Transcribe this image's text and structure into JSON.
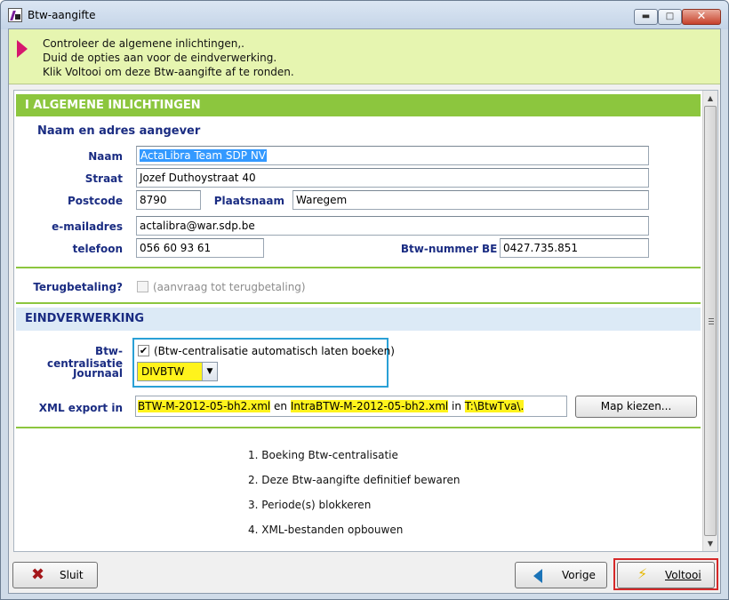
{
  "window": {
    "title": "Btw-aangifte"
  },
  "info": {
    "lines": [
      "Controleer de algemene inlichtingen,.",
      "Duid de opties aan voor de eindverwerking.",
      "Klik Voltooi om deze Btw-aangifte af te ronden."
    ]
  },
  "general": {
    "header": "I  ALGEMENE INLICHTINGEN",
    "subheader": "Naam en adres aangever",
    "name_label": "Naam",
    "name_value": "ActaLibra Team SDP NV",
    "street_label": "Straat",
    "street_value": "Jozef Duthoystraat 40",
    "postcode_label": "Postcode",
    "postcode_value": "8790",
    "city_label": "Plaatsnaam",
    "city_value": "Waregem",
    "email_label": "e-mailadres",
    "email_value": "actalibra@war.sdp.be",
    "phone_label": "telefoon",
    "phone_value": "056 60 93 61",
    "vat_label": "Btw-nummer",
    "vat_prefix": "BE",
    "vat_value": "0427.735.851",
    "refund_label": "Terugbetaling?",
    "refund_option": "(aanvraag tot terugbetaling)"
  },
  "final": {
    "header": "EINDVERWERKING",
    "central_label": "Btw-centralisatie",
    "central_option": "(Btw-centralisatie automatisch laten boeken)",
    "central_check": "✔",
    "journal_label": "Journaal",
    "journal_value": "DIVBTW",
    "xml_label": "XML export in",
    "xml_file1": "BTW-M-2012-05-bh2.xml",
    "xml_and": " en ",
    "xml_file2": "IntraBTW-M-2012-05-bh2.xml",
    "xml_in": " in ",
    "xml_folder": "T:\\BtwTva\\.",
    "map_button": "Map kiezen...",
    "steps": [
      "1. Boeking Btw-centralisatie",
      "2. Deze Btw-aangifte definitief  bewaren",
      "3. Periode(s) blokkeren",
      "4. XML-bestanden opbouwen"
    ]
  },
  "footer": {
    "close_label": "Sluit",
    "prev_label": "Vorige",
    "finish_label": "Voltooi"
  },
  "colors": {
    "green_header": "#8cc63e",
    "blue_section": "#dceaf6",
    "label_blue": "#1a2c82",
    "highlight": "#fff31c",
    "info_bar": "#e6f5b0"
  }
}
